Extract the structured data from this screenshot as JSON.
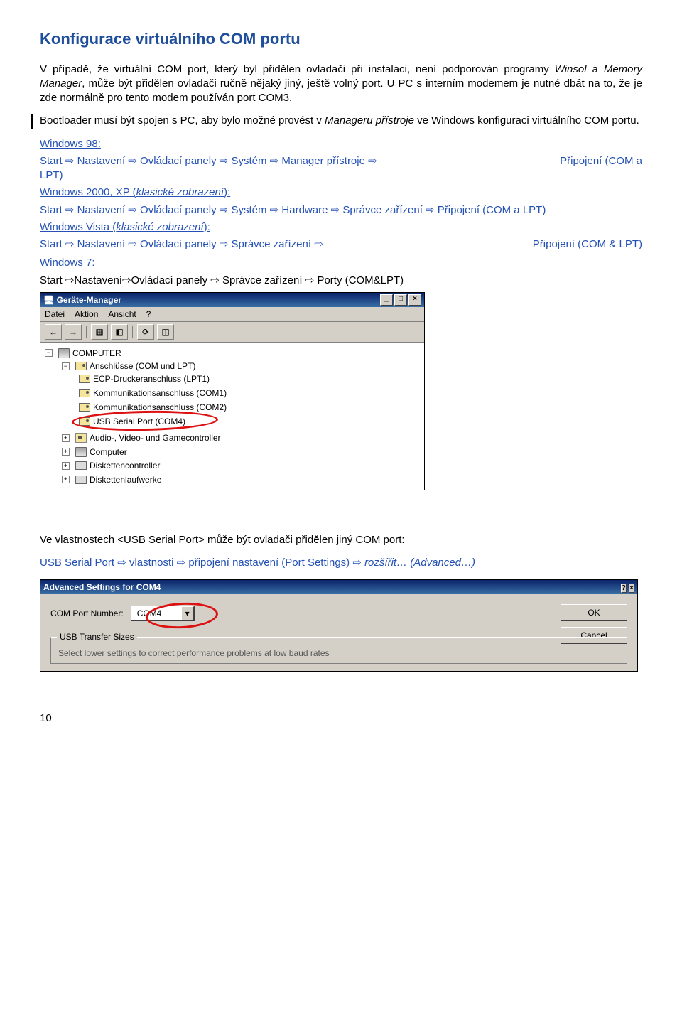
{
  "heading": "Konfigurace virtuálního COM portu",
  "intro_parts": {
    "p1a": "V případě, že virtuální COM port, který byl přidělen ovladači při instalaci, není podporován programy ",
    "p1b": "Winsol",
    "p1c": " a ",
    "p1d": "Memory Manager",
    "p1e": ", může být přidělen ovladači ručně nějaký jiný, ještě volný port. U PC s interním modemem je nutné dbát na to, že je zde normálně pro tento modem používán port COM3."
  },
  "boot_parts": {
    "a": "Bootloader musí být spojen s PC, aby bylo možné provést v ",
    "b": "Manageru přístroje",
    "c": " ve Windows konfiguraci  virtuálního COM portu."
  },
  "arrow": "⇨",
  "navs": {
    "w98_label": "Windows 98:",
    "w98_left": "Start ⇨ Nastavení ⇨ Ovládací panely ⇨ Systém ⇨ Manager přístroje ⇨",
    "w98_lpt": "LPT)",
    "w98_right": "Připojení (COM a",
    "w2000_label": "Windows 2000, XP (klasické zobrazení):",
    "w2000_left": "Start ⇨ Nastavení ⇨ Ovládací panely ⇨ Systém ⇨ Hardware ⇨ Správce zařízení ⇨     Připojení (COM a LPT)",
    "vista_label": "Windows Vista (klasické zobrazení):",
    "vista_left": "Start ⇨ Nastavení ⇨ Ovládací panely ⇨ Správce zařízení ⇨",
    "vista_right": "Připojení (COM & LPT)",
    "w7_label": "Windows 7:",
    "w7_black": "Start ⇨Nastavení⇨Ovládací panely ⇨ Správce zařízení ⇨ Porty (COM&LPT)"
  },
  "devmgr": {
    "title_icon": "🖥",
    "title": "Geräte-Manager",
    "menus": [
      "Datei",
      "Aktion",
      "Ansicht",
      "?"
    ],
    "tree": {
      "root": "COMPUTER",
      "ports_label": "Anschlüsse (COM und LPT)",
      "ports": [
        "ECP-Druckeranschluss (LPT1)",
        "Kommunikationsanschluss (COM1)",
        "Kommunikationsanschluss (COM2)",
        "USB Serial Port (COM4)"
      ],
      "other": [
        "Audio-, Video- und Gamecontroller",
        "Computer",
        "Diskettencontroller",
        "Diskettenlaufwerke"
      ]
    },
    "win_btns": [
      "_",
      "□",
      "×"
    ]
  },
  "note_parts": {
    "a": "Ve vlastnostech <USB Serial Port> může být ovladači přidělen jiný COM port:",
    "line2_left": "USB Serial Port ⇨ vlastnosti ⇨ připojení nastavení (Port Settings) ⇨ ",
    "line2_ital": "rozšířit… (Advanced…)"
  },
  "adv": {
    "title": "Advanced Settings for COM4",
    "help_x": [
      "?",
      "×"
    ],
    "label": "COM Port Number:",
    "value": "COM4",
    "ok": "OK",
    "cancel": "Cancel",
    "group": "USB Transfer Sizes",
    "hint": "Select lower settings to correct performance problems at low baud rates"
  },
  "page_num": "10"
}
